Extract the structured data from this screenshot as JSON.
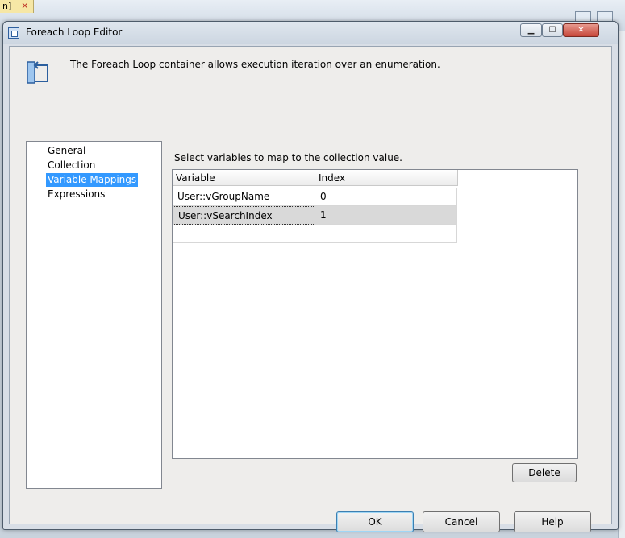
{
  "dialog": {
    "title": "Foreach Loop Editor",
    "description": "The Foreach Loop container allows execution iteration over an enumeration."
  },
  "nav": {
    "items": [
      {
        "label": "General",
        "selected": false
      },
      {
        "label": "Collection",
        "selected": false
      },
      {
        "label": "Variable Mappings",
        "selected": true
      },
      {
        "label": "Expressions",
        "selected": false
      }
    ]
  },
  "mappings": {
    "instruction": "Select variables to map to the collection value.",
    "columns": [
      "Variable",
      "Index"
    ],
    "rows": [
      {
        "variable": "User::vGroupName",
        "index": "0"
      },
      {
        "variable": "User::vSearchIndex",
        "index": "1"
      },
      {
        "variable": "",
        "index": ""
      }
    ]
  },
  "buttons": {
    "delete": "Delete",
    "ok": "OK",
    "cancel": "Cancel",
    "help": "Help"
  },
  "colors": {
    "selection": "#3399ff",
    "dialog_bg": "#eeedeb"
  }
}
